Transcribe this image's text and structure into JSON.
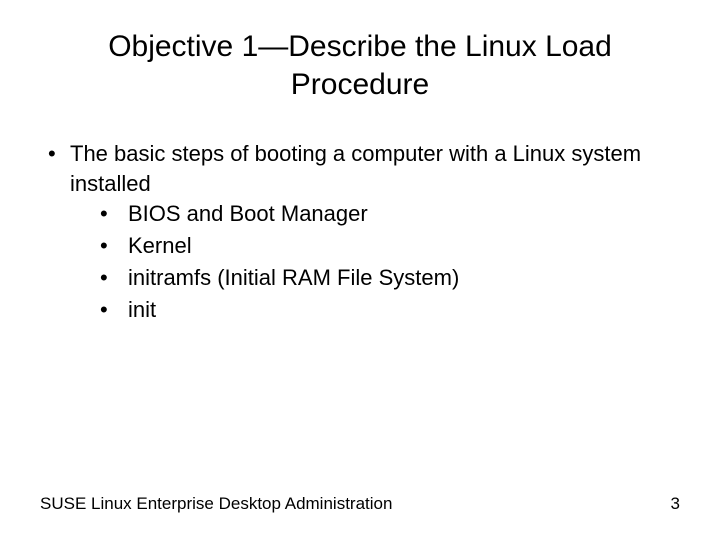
{
  "title": "Objective 1—Describe the Linux Load Procedure",
  "main_bullet": "The basic steps of booting a computer with a Linux system installed",
  "sub_bullets": [
    "BIOS and Boot Manager",
    "Kernel",
    "initramfs (Initial RAM File System)",
    "init"
  ],
  "footer_left": "SUSE Linux Enterprise Desktop Administration",
  "footer_right": "3"
}
